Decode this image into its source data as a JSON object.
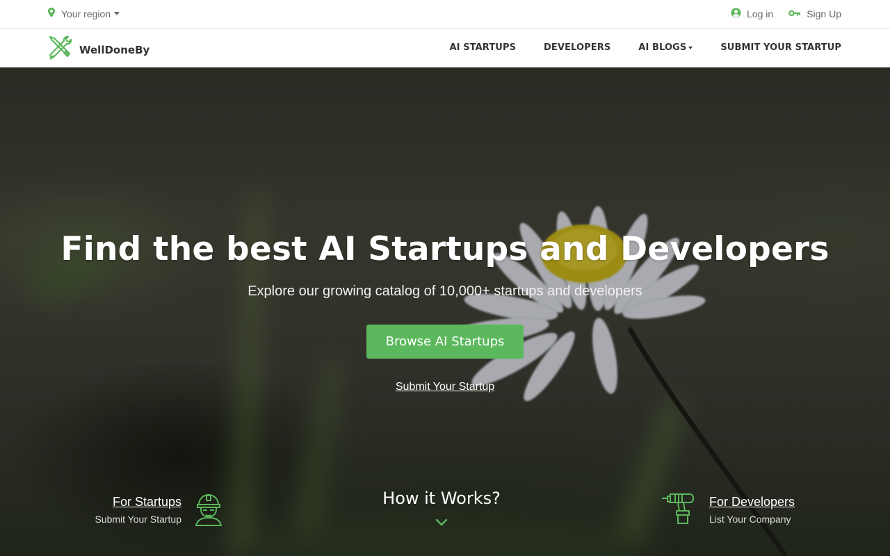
{
  "topbar": {
    "region_label": "Your region",
    "login_label": "Log in",
    "signup_label": "Sign Up"
  },
  "navbar": {
    "brand": "WellDoneBy",
    "items": [
      {
        "label": "AI STARTUPS",
        "icon": "none"
      },
      {
        "label": "DEVELOPERS",
        "icon": "none"
      },
      {
        "label": "AI BLOGS",
        "icon": "caret-down-icon"
      },
      {
        "label": "SUBMIT YOUR STARTUP",
        "icon": "none"
      }
    ]
  },
  "hero": {
    "title": "Find the best AI Startups and Developers",
    "subtitle": "Explore our growing catalog of 10,000+ startups and developers",
    "cta_label": "Browse AI Startups",
    "secondary_link": "Submit Your Startup",
    "how_it_works": "How it Works?"
  },
  "features": {
    "startups": {
      "title": "For Startups",
      "subtitle": "Submit Your Startup",
      "icon": "worker-helmet-icon"
    },
    "developers": {
      "title": "For Developers",
      "subtitle": "List Your Company",
      "icon": "drill-icon"
    }
  },
  "colors": {
    "accent": "#5cb85c",
    "nav_text": "#333333",
    "muted_text": "#666666"
  }
}
